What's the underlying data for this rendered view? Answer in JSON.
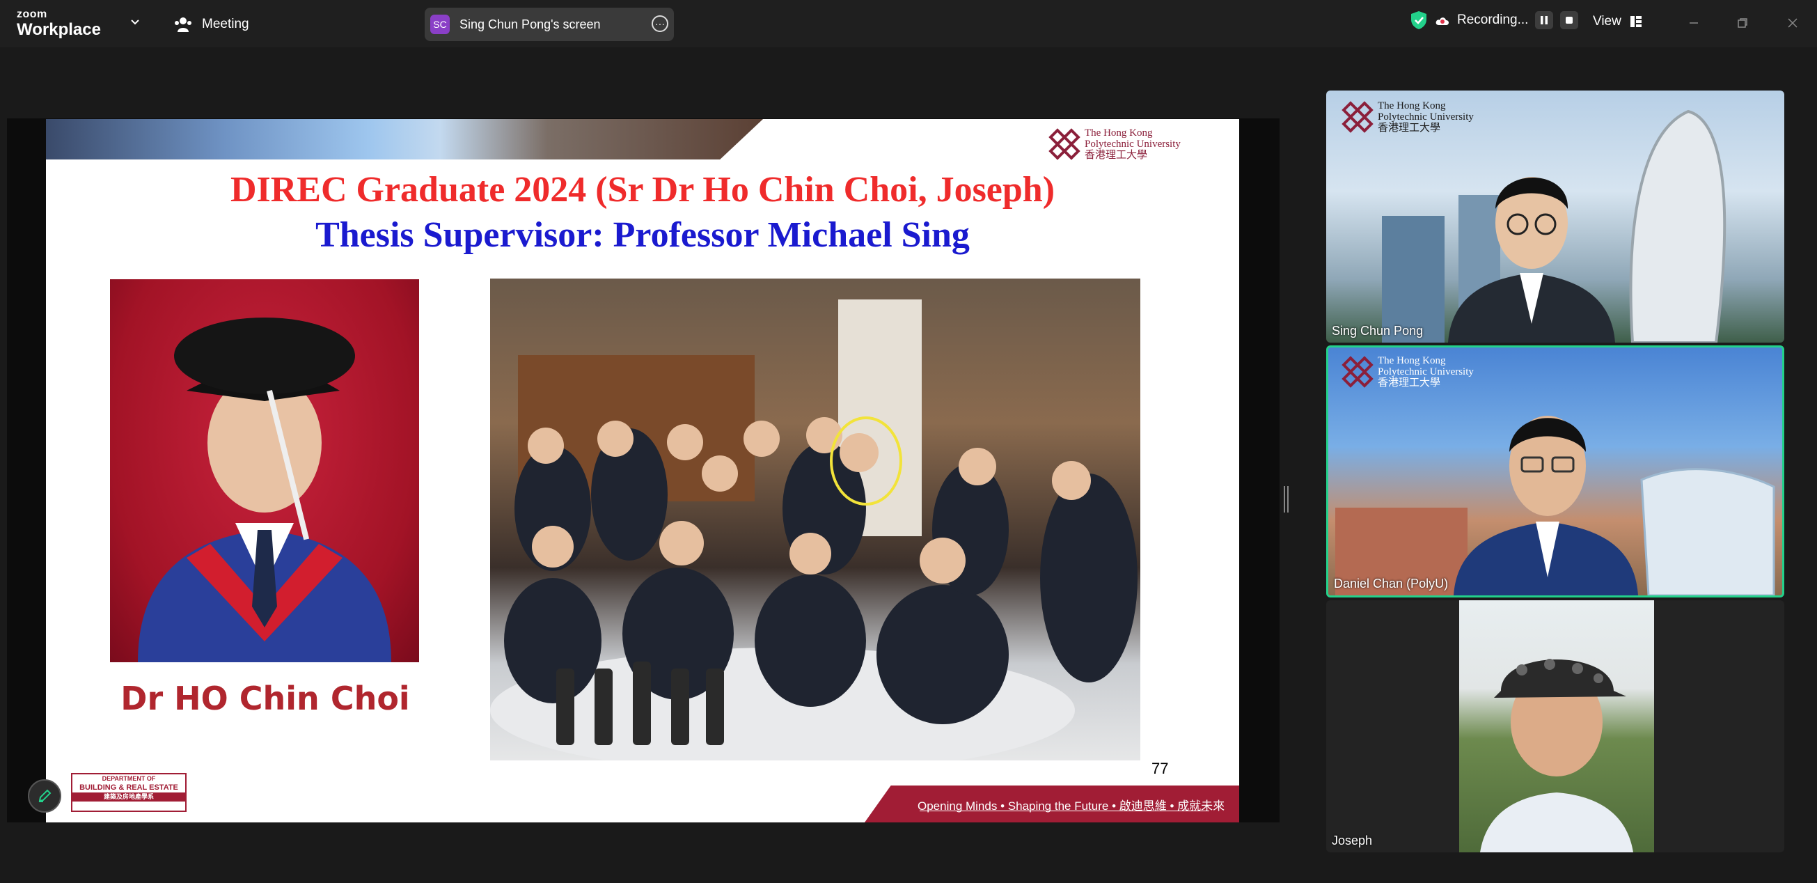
{
  "app": {
    "brand_top": "zoom",
    "brand_bottom": "Workplace",
    "meeting_label": "Meeting",
    "screen_initials": "SC",
    "screen_label": "Sing Chun Pong's screen",
    "recording_label": "Recording...",
    "view_label": "View",
    "accent_color": "#23d18b"
  },
  "slide": {
    "title_line1": "DIREC Graduate 2024 (Sr Dr Ho Chin Choi, Joseph)",
    "title_line2": "Thesis Supervisor: Professor Michael Sing",
    "portrait_caption": "Dr HO Chin Choi",
    "page_number": "77",
    "footer_tagline": "Opening Minds • Shaping the Future • 啟迪思維 • 成就未來",
    "uni_logo": {
      "line1": "The Hong Kong",
      "line2": "Polytechnic University",
      "line3": "香港理工大學"
    },
    "dept_logo": {
      "line1": "DEPARTMENT OF",
      "line2": "BUILDING & REAL ESTATE",
      "line3": "建築及房地產學系"
    },
    "title1_color": "#ef2b2b",
    "title2_color": "#1a1acf"
  },
  "participants": [
    {
      "name": "Sing Chun Pong",
      "logo": {
        "line1": "The Hong Kong",
        "line2": "Polytechnic University",
        "line3": "香港理工大學"
      }
    },
    {
      "name": "Daniel Chan (PolyU)",
      "logo": {
        "line1": "The Hong Kong",
        "line2": "Polytechnic University",
        "line3": "香港理工大學"
      }
    },
    {
      "name": "Joseph"
    }
  ]
}
